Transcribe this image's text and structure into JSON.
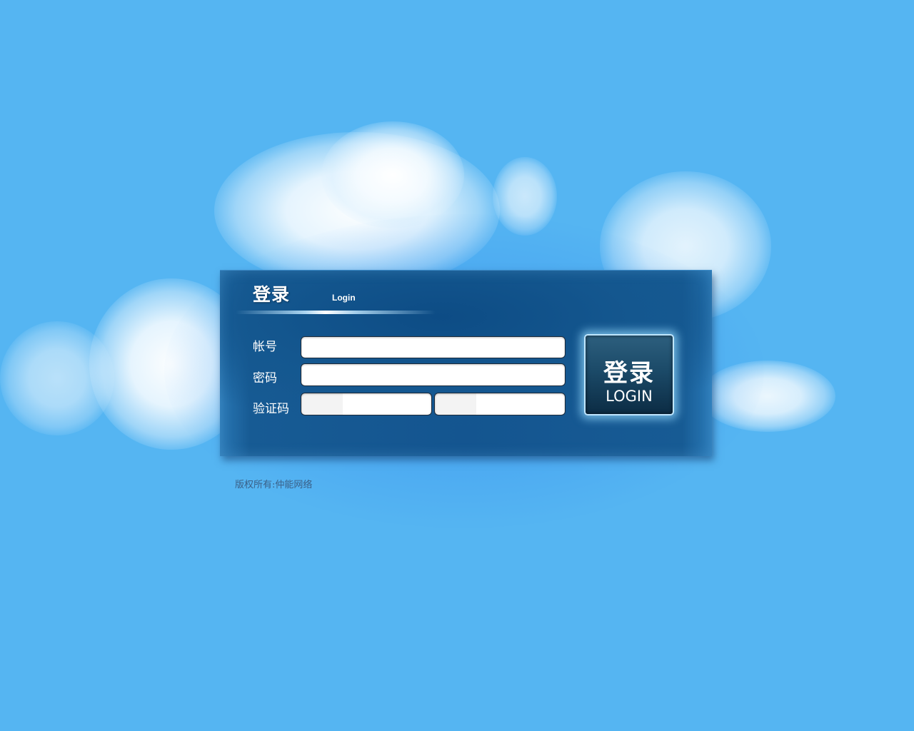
{
  "login_panel": {
    "title": "登录",
    "subtitle": "Login",
    "fields": {
      "account_label": "帐号",
      "account_value": "",
      "password_label": "密码",
      "password_value": "",
      "captcha_label": "验证码",
      "captcha_value": "",
      "captcha_extra_value": ""
    },
    "login_button": {
      "label_cn": "登录",
      "label_en": "LOGIN"
    }
  },
  "footer": {
    "copyright": "版权所有:仲能网络"
  },
  "colors": {
    "background": "#55b5f2",
    "panel": "#14558f",
    "button": "#1b4a68",
    "copyright_text": "#3a5f86"
  }
}
